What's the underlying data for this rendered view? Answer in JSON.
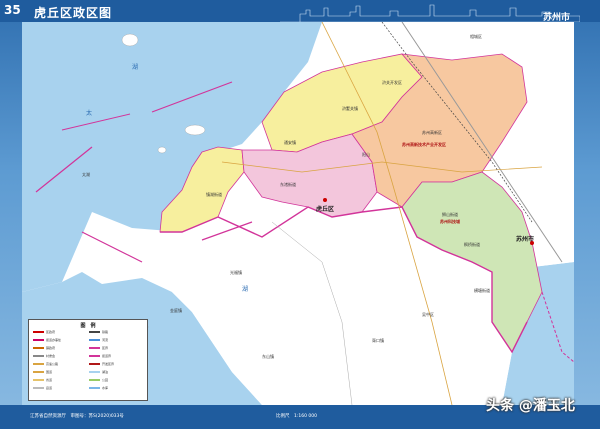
{
  "page_number": "35",
  "title": "虎丘区政区图",
  "brand": "苏州市",
  "map": {
    "district_main": "虎丘区",
    "neighbor_city": "苏州市",
    "labels": [
      {
        "id": "l1",
        "text": "浒墅关镇"
      },
      {
        "id": "l2",
        "text": "通安镇"
      },
      {
        "id": "l3",
        "text": "东渚街道"
      },
      {
        "id": "l4",
        "text": "镇湖街道"
      },
      {
        "id": "l5",
        "text": "狮山街道"
      },
      {
        "id": "l6",
        "text": "枫桥街道"
      },
      {
        "id": "l7",
        "text": "横塘街道"
      },
      {
        "id": "l8",
        "text": "胥口镇"
      },
      {
        "id": "l9",
        "text": "东山镇"
      },
      {
        "id": "l10",
        "text": "金庭镇"
      },
      {
        "id": "l11",
        "text": "光福镇"
      },
      {
        "id": "l12",
        "text": "浒关开发区"
      },
      {
        "id": "l13",
        "text": "苏州高新区"
      },
      {
        "id": "l14",
        "text": "阳山"
      },
      {
        "id": "l15",
        "text": "太湖"
      },
      {
        "id": "l16",
        "text": "吴中区"
      },
      {
        "id": "l17",
        "text": "相城区"
      }
    ],
    "red_labels": [
      {
        "id": "r1",
        "text": "苏州高新技术产业开发区"
      },
      {
        "id": "r2",
        "text": "苏州科技城"
      }
    ],
    "water_labels": [
      {
        "id": "w1",
        "text": "太"
      },
      {
        "id": "w2",
        "text": "湖"
      },
      {
        "id": "w3",
        "text": "湖"
      }
    ]
  },
  "legend": {
    "title": "图　例",
    "items": [
      "区政府",
      "街道办事处",
      "镇政府",
      "村委会",
      "高速公路",
      "国道",
      "省道",
      "县道",
      "铁路",
      "河流",
      "区界",
      "街道界",
      "开发区界",
      "湖泊",
      "公园",
      "水库"
    ]
  },
  "footer": {
    "publisher": "江苏省自然资源厅　审图号：苏S(2020)033号",
    "scale": "比例尺　1:160 000",
    "date": "2020年11月"
  },
  "watermark": "头条 @潘玉北",
  "colors": {
    "frame": "#1f5c9e",
    "lake": "#a8d2ee",
    "yellow": "#f7ef9e",
    "pink": "#f3c6dc",
    "orange": "#f7c8a0",
    "green": "#cfe6b6",
    "boundary": "#d2349a"
  }
}
